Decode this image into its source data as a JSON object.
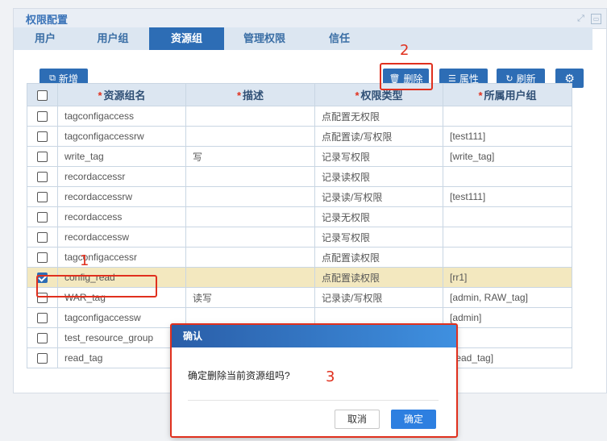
{
  "panel": {
    "title": "权限配置",
    "header_icons": [
      "expand-icon",
      "restore-icon"
    ]
  },
  "tabs": [
    {
      "label": "用户",
      "active": false
    },
    {
      "label": "用户组",
      "active": false
    },
    {
      "label": "资源组",
      "active": true
    },
    {
      "label": "管理权限",
      "active": false
    },
    {
      "label": "信任",
      "active": false
    }
  ],
  "toolbar": {
    "new_label": "新增",
    "delete_label": "删除",
    "properties_label": "属性",
    "refresh_label": "刷新"
  },
  "table": {
    "columns": [
      {
        "label": "资源组名",
        "required": true
      },
      {
        "label": "描述",
        "required": true
      },
      {
        "label": "权限类型",
        "required": true
      },
      {
        "label": "所属用户组",
        "required": true
      }
    ],
    "rows": [
      {
        "name": "tagconfigaccess",
        "desc": "",
        "perm": "点配置无权限",
        "group": "",
        "checked": false
      },
      {
        "name": "tagconfigaccessrw",
        "desc": "",
        "perm": "点配置读/写权限",
        "group": "[test111]",
        "checked": false
      },
      {
        "name": "write_tag",
        "desc": "写",
        "perm": "记录写权限",
        "group": "[write_tag]",
        "checked": false
      },
      {
        "name": "recordaccessr",
        "desc": "",
        "perm": "记录读权限",
        "group": "",
        "checked": false
      },
      {
        "name": "recordaccessrw",
        "desc": "",
        "perm": "记录读/写权限",
        "group": "[test111]",
        "checked": false
      },
      {
        "name": "recordaccess",
        "desc": "",
        "perm": "记录无权限",
        "group": "",
        "checked": false
      },
      {
        "name": "recordaccessw",
        "desc": "",
        "perm": "记录写权限",
        "group": "",
        "checked": false
      },
      {
        "name": "tagconfigaccessr",
        "desc": "",
        "perm": "点配置读权限",
        "group": "",
        "checked": false
      },
      {
        "name": "config_read",
        "desc": "",
        "perm": "点配置读权限",
        "group": "[rr1]",
        "checked": true
      },
      {
        "name": "WAR_tag",
        "desc": "读写",
        "perm": "记录读/写权限",
        "group": "[admin, RAW_tag]",
        "checked": false
      },
      {
        "name": "tagconfigaccessw",
        "desc": "",
        "perm": "",
        "group": "[admin]",
        "checked": false
      },
      {
        "name": "test_resource_group",
        "desc": "",
        "perm": "",
        "group": "",
        "checked": false
      },
      {
        "name": "read_tag",
        "desc": "",
        "perm": "",
        "group": "[read_tag]",
        "checked": false
      }
    ]
  },
  "annotations": {
    "n1": "1",
    "n2": "2",
    "n3": "3",
    "color": "#e0301e"
  },
  "dialog": {
    "title": "确认",
    "message": "确定删除当前资源组吗?",
    "cancel_label": "取消",
    "ok_label": "确定"
  },
  "colors": {
    "primary": "#2d6db5",
    "selected_row": "#f3e8bf",
    "header_bg": "#dce6f1"
  }
}
